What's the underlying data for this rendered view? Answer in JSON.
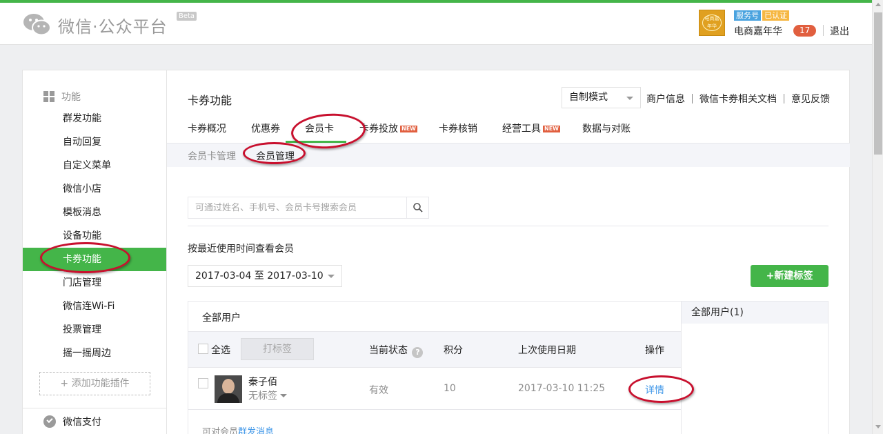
{
  "header": {
    "logo_text": "微信·公众平台",
    "beta": "Beta",
    "account_avatar_text": "电商嘉年华",
    "badge_service": "服务号",
    "badge_verified": "已认证",
    "account_name": "电商嘉年华",
    "message_count": "17",
    "logout": "退出"
  },
  "sidebar": {
    "section_title": "功能",
    "items": [
      {
        "label": "群发功能"
      },
      {
        "label": "自动回复"
      },
      {
        "label": "自定义菜单"
      },
      {
        "label": "微信小店"
      },
      {
        "label": "模板消息"
      },
      {
        "label": "设备功能"
      },
      {
        "label": "卡券功能",
        "active": true
      },
      {
        "label": "门店管理"
      },
      {
        "label": "微信连Wi-Fi"
      },
      {
        "label": "投票管理"
      },
      {
        "label": "摇一摇周边"
      }
    ],
    "add_plugin": "+ 添加功能插件",
    "pay": "微信支付"
  },
  "main": {
    "title": "卡券功能",
    "mode_select": "自制模式",
    "links": [
      "商户信息",
      "微信卡券相关文档",
      "意见反馈"
    ],
    "tabs": [
      {
        "label": "卡券概况"
      },
      {
        "label": "优惠券"
      },
      {
        "label": "会员卡",
        "active": true
      },
      {
        "label": "卡券投放",
        "new": true
      },
      {
        "label": "卡券核销"
      },
      {
        "label": "经营工具",
        "new": true
      },
      {
        "label": "数据与对账"
      }
    ],
    "new_badge": "NEW",
    "subtabs": [
      {
        "label": "会员卡管理"
      },
      {
        "label": "会员管理",
        "active": true
      }
    ],
    "search_placeholder": "可通过姓名、手机号、会员卡号搜索会员",
    "filter_label": "按最近使用时间查看会员",
    "date_range": "2017-03-04 至 2017-03-10",
    "new_tag_button": "+新建标签",
    "table": {
      "title": "全部用户",
      "select_all": "全选",
      "tag_button": "打标签",
      "columns": [
        "当前状态",
        "积分",
        "上次使用日期",
        "操作"
      ],
      "help": "?",
      "rows": [
        {
          "name": "秦子佰",
          "tag": "无标签",
          "status": "有效",
          "points": "10",
          "last_used": "2017-03-10 11:25",
          "action": "详情"
        }
      ],
      "footer_prefix": "可对会员",
      "footer_link": "群发消息"
    },
    "right_panel": {
      "title": "全部用户(1)"
    }
  },
  "colors": {
    "accent": "#44b549",
    "link": "#459ae9",
    "highlight": "#c8102e"
  }
}
